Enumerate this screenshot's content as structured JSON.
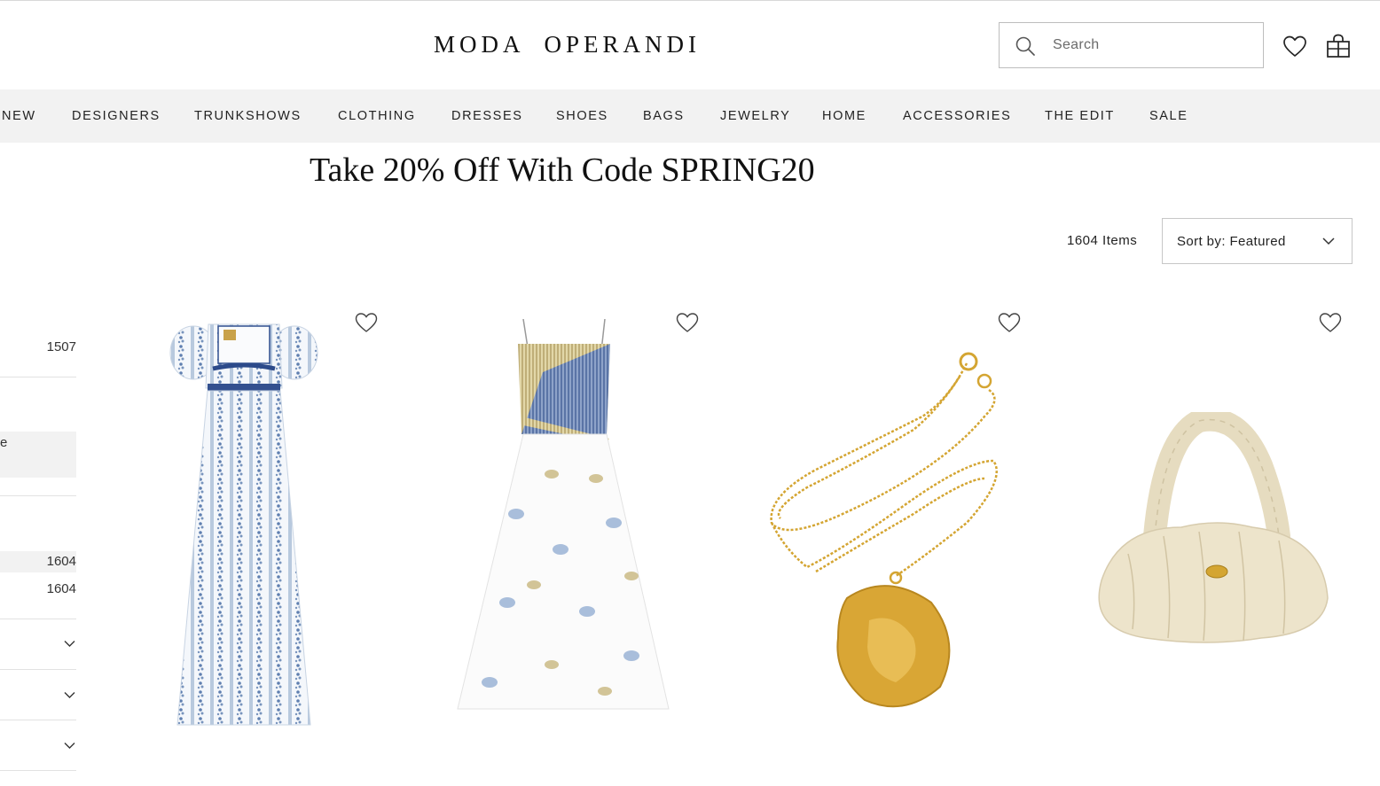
{
  "header": {
    "logo_word1": "MODA",
    "logo_word2": "OPERANDI",
    "search_placeholder": "Search",
    "search_value": "",
    "icons": [
      "search-icon",
      "heart-icon",
      "shopping-bag-icon"
    ]
  },
  "nav": {
    "items": [
      {
        "label": "NEW"
      },
      {
        "label": "DESIGNERS"
      },
      {
        "label": "TRUNKSHOWS"
      },
      {
        "label": "CLOTHING"
      },
      {
        "label": "DRESSES"
      },
      {
        "label": "SHOES"
      },
      {
        "label": "BAGS"
      },
      {
        "label": "JEWELRY"
      },
      {
        "label": "HOME"
      },
      {
        "label": "ACCESSORIES"
      },
      {
        "label": "THE EDIT"
      },
      {
        "label": "SALE"
      }
    ]
  },
  "promo": {
    "headline": "Take 20% Off With Code SPRING20"
  },
  "listing": {
    "items_count": "1604 Items",
    "sort_label": "Sort by: Featured"
  },
  "sidebar": {
    "count_1": "1507",
    "fragment_text": "e",
    "count_2": "1604",
    "count_3": "1604"
  },
  "products": [
    {
      "icon": "floral-maxi-dress"
    },
    {
      "icon": "paisley-wrap-dress"
    },
    {
      "icon": "gold-coin-necklace"
    },
    {
      "icon": "ruched-shoulder-bag"
    }
  ],
  "colors": {
    "nav_bg": "#f2f2f2",
    "text": "#1a1a1a",
    "border": "#c7c7c7"
  }
}
